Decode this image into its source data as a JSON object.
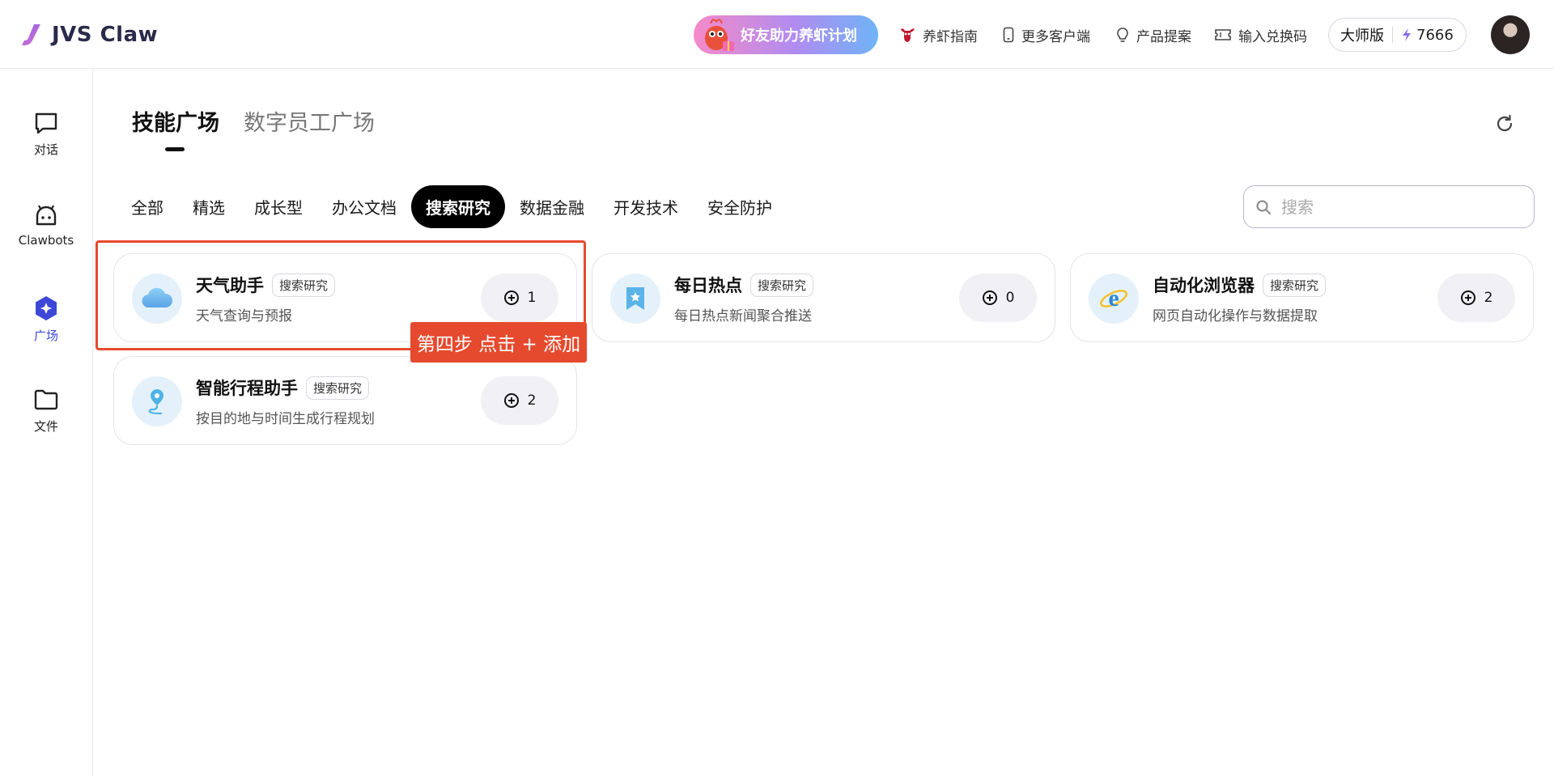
{
  "app": {
    "logo_text": "JVS Claw",
    "accent_color": "#3d49d6",
    "annotation_color": "#e64a2e"
  },
  "header": {
    "promo_text": "好友助力养虾计划",
    "links": [
      {
        "label": "养虾指南",
        "icon": "shrimp-icon"
      },
      {
        "label": "更多客户端",
        "icon": "phone-icon"
      },
      {
        "label": "产品提案",
        "icon": "lightbulb-icon"
      },
      {
        "label": "输入兑换码",
        "icon": "ticket-icon"
      }
    ],
    "plan": {
      "name": "大师版",
      "credits": "7666"
    }
  },
  "sidebar": {
    "items": [
      {
        "label": "对话",
        "icon": "chat-icon",
        "active": false
      },
      {
        "label": "Clawbots",
        "icon": "bot-icon",
        "active": false
      },
      {
        "label": "广场",
        "icon": "plaza-icon",
        "active": true
      },
      {
        "label": "文件",
        "icon": "folder-icon",
        "active": false
      }
    ]
  },
  "main": {
    "tabs": [
      {
        "label": "技能广场",
        "active": true
      },
      {
        "label": "数字员工广场",
        "active": false
      }
    ],
    "categories": [
      {
        "label": "全部",
        "active": false
      },
      {
        "label": "精选",
        "active": false
      },
      {
        "label": "成长型",
        "active": false
      },
      {
        "label": "办公文档",
        "active": false
      },
      {
        "label": "搜索研究",
        "active": true
      },
      {
        "label": "数据金融",
        "active": false
      },
      {
        "label": "开发技术",
        "active": false
      },
      {
        "label": "安全防护",
        "active": false
      }
    ],
    "search": {
      "placeholder": "搜索",
      "value": ""
    },
    "skills": [
      {
        "title": "天气助手",
        "tag": "搜索研究",
        "desc": "天气查询与预报",
        "count": "1",
        "icon": "cloud-icon"
      },
      {
        "title": "每日热点",
        "tag": "搜索研究",
        "desc": "每日热点新闻聚合推送",
        "count": "0",
        "icon": "bookmark-star-icon"
      },
      {
        "title": "自动化浏览器",
        "tag": "搜索研究",
        "desc": "网页自动化操作与数据提取",
        "count": "2",
        "icon": "browser-e-icon"
      },
      {
        "title": "智能行程助手",
        "tag": "搜索研究",
        "desc": "按目的地与时间生成行程规划",
        "count": "2",
        "icon": "location-route-icon"
      }
    ]
  },
  "annotation": {
    "step_label": "第四步 点击 + 添加"
  }
}
